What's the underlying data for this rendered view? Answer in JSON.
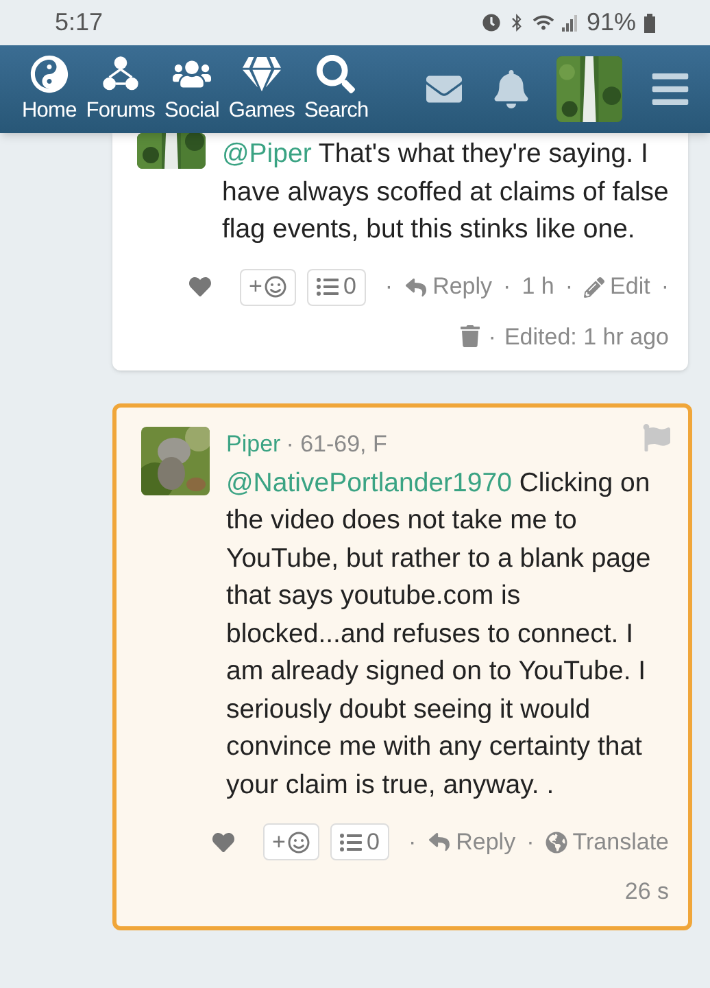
{
  "status_bar": {
    "time": "5:17",
    "battery": "91%"
  },
  "nav": {
    "items": [
      {
        "kind": "home",
        "label": "Home"
      },
      {
        "kind": "forums",
        "label": "Forums"
      },
      {
        "kind": "social",
        "label": "Social"
      },
      {
        "kind": "games",
        "label": "Games"
      },
      {
        "kind": "search",
        "label": "Search"
      }
    ]
  },
  "posts": [
    {
      "highlighted": false,
      "mention": "@Piper",
      "text": "That's what they're saying. I have always scoffed at claims of false flag events, but this stinks like one.",
      "react_label": "+",
      "list_count": "0",
      "actions": [
        {
          "kind": "dot",
          "label": "·"
        },
        {
          "kind": "reply",
          "label": "Reply"
        },
        {
          "kind": "dot",
          "label": "·"
        },
        {
          "kind": "text",
          "label": "1 h"
        },
        {
          "kind": "dot",
          "label": "·"
        },
        {
          "kind": "edit",
          "label": "Edit"
        },
        {
          "kind": "dot",
          "label": "·"
        }
      ],
      "footer": [
        {
          "kind": "trash"
        },
        {
          "kind": "dot",
          "label": "·"
        },
        {
          "kind": "text",
          "label": "Edited: 1 hr ago"
        }
      ]
    },
    {
      "highlighted": true,
      "author": "Piper",
      "meta": "· 61-69, F",
      "mention": "@NativePortlander1970",
      "text": "Clicking on the video does not take me to YouTube, but rather to a blank page that says youtube.com is blocked...and refuses to connect. I am already signed on to YouTube. I seriously doubt seeing it would convince me with any certainty that your claim is true, anyway. .",
      "react_label": "+",
      "list_count": "0",
      "actions": [
        {
          "kind": "dot",
          "label": "·"
        },
        {
          "kind": "reply",
          "label": "Reply"
        },
        {
          "kind": "dot",
          "label": "·"
        },
        {
          "kind": "translate",
          "label": "Translate"
        }
      ],
      "footer": [
        {
          "kind": "text",
          "label": "26 s"
        }
      ]
    }
  ]
}
